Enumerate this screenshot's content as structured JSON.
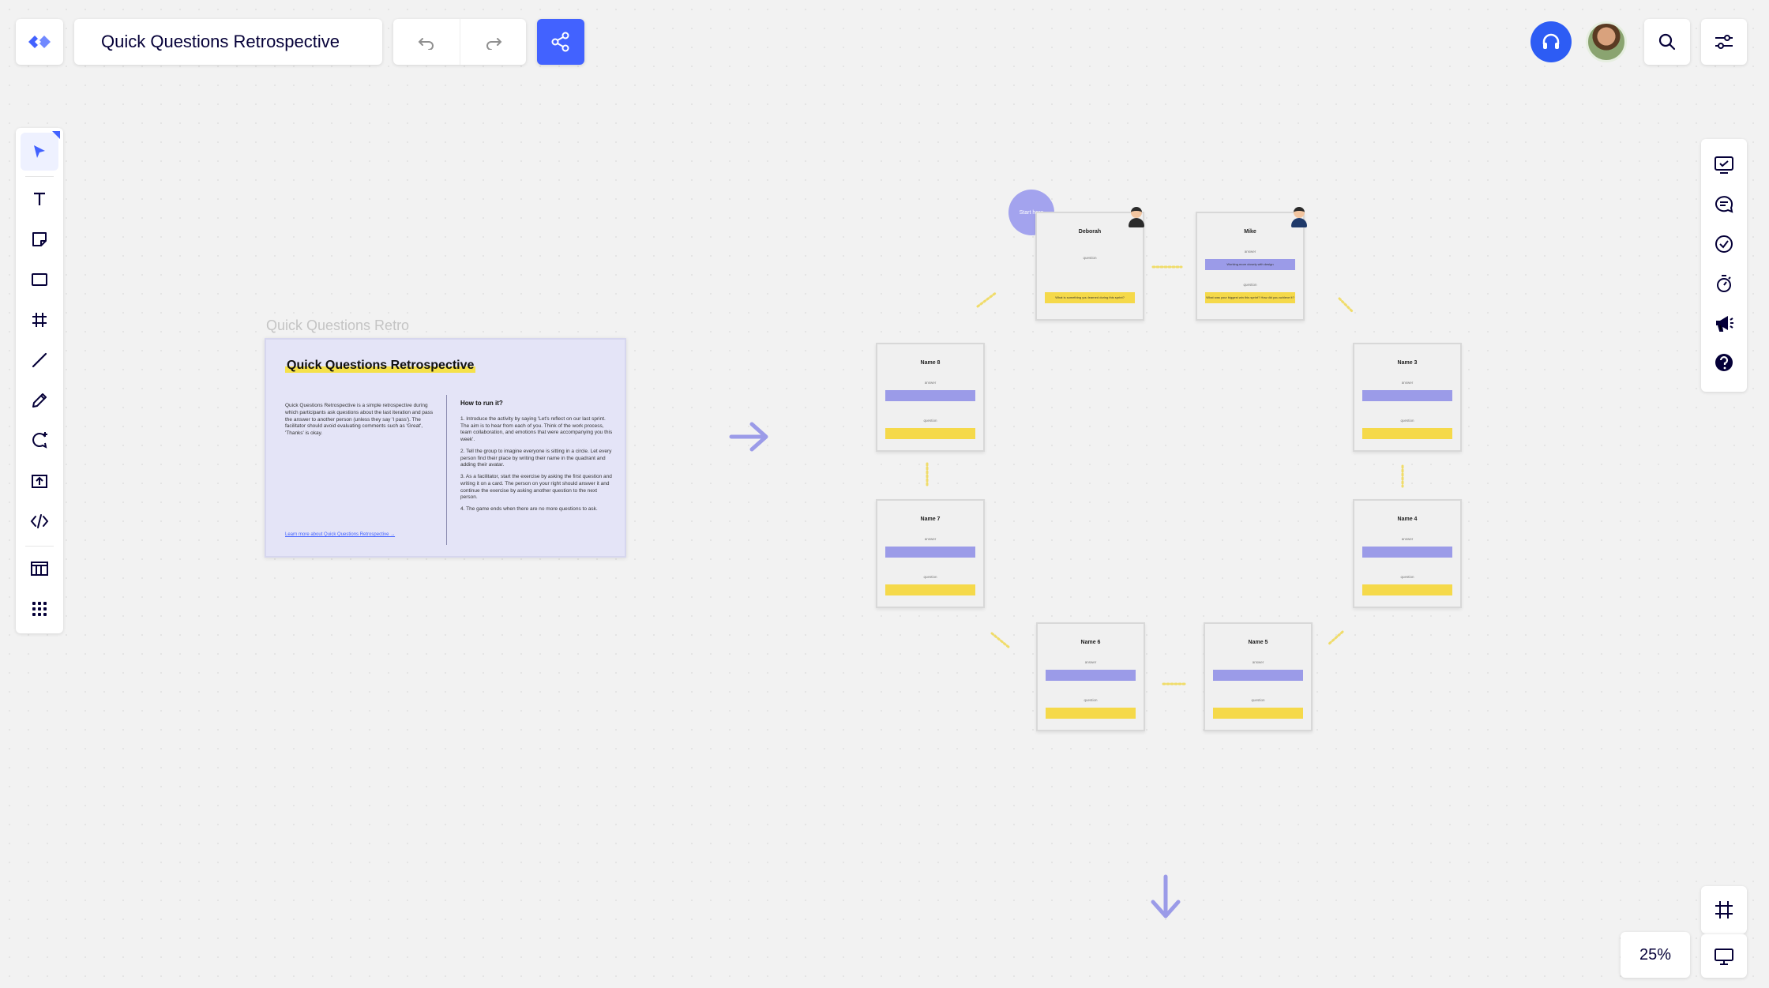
{
  "app": {
    "board_title": "Quick Questions Retrospective",
    "zoom": "25%",
    "accent": "#4262ff"
  },
  "toolbar_top": {
    "logo_icon": "miro-logo-icon",
    "undo_icon": "undo-icon",
    "redo_icon": "redo-icon",
    "share_icon": "share-icon"
  },
  "left_tools": [
    {
      "name": "select-tool",
      "icon": "cursor-arrow-icon",
      "active": true
    },
    {
      "name": "text-tool",
      "icon": "text-icon"
    },
    {
      "name": "sticky-note-tool",
      "icon": "sticky-note-icon"
    },
    {
      "name": "shape-tool",
      "icon": "rectangle-icon"
    },
    {
      "name": "frame-tool",
      "icon": "frame-icon"
    },
    {
      "name": "line-tool",
      "icon": "line-icon"
    },
    {
      "name": "pen-tool",
      "icon": "pen-icon"
    },
    {
      "name": "comment-tool",
      "icon": "comment-add-icon"
    },
    {
      "name": "upload-tool",
      "icon": "upload-icon"
    },
    {
      "name": "embed-tool",
      "icon": "code-icon"
    },
    {
      "name": "templates-tool",
      "icon": "templates-icon"
    },
    {
      "name": "more-apps-tool",
      "icon": "grid-dots-icon"
    }
  ],
  "right_tools": [
    {
      "name": "activity-tool",
      "icon": "board-check-icon"
    },
    {
      "name": "chat-tool",
      "icon": "chat-icon"
    },
    {
      "name": "tasks-tool",
      "icon": "check-circle-icon"
    },
    {
      "name": "timer-tool",
      "icon": "timer-icon"
    },
    {
      "name": "announcements-tool",
      "icon": "megaphone-icon"
    },
    {
      "name": "help-tool",
      "icon": "help-icon"
    }
  ],
  "board": {
    "frame_label": "Quick Questions Retro",
    "info_card": {
      "title": "Quick Questions Retrospective",
      "left_text": "Quick Questions Retrospective is a simple retrospective during which participants ask questions about the last iteration and pass the answer to another person (unless they say 'I pass'). The facilitator should avoid evaluating comments such as 'Great', 'Thanks' is okay.",
      "how_title": "How to run it?",
      "steps": [
        "1. Introduce the activity by saying 'Let's reflect on our last sprint. The aim is to hear from each of you. Think of the work process, team collaboration, and emotions that were accompanying you this week'.",
        "2. Tell the group to imagine everyone is sitting in a circle. Let every person find their place by writing their name in the quadrant and adding their avatar.",
        "3. As a facilitator, start the exercise by asking the first question and writing it on a card. The person on your right should answer it and continue the exercise by asking another question to the next person.",
        "4. The game ends when there are no more questions to ask."
      ],
      "link": "Learn more about Quick Questions Retrospective →"
    },
    "start_here": "Start here",
    "cards": [
      {
        "name": "Deborah",
        "answer_label": "",
        "question_label": "question",
        "answer_text": "",
        "question_text": "What is something you learned during this sprint?"
      },
      {
        "name": "Mike",
        "answer_label": "answer",
        "question_label": "question",
        "answer_text": "Working more closely with design",
        "question_text": "What was your biggest win this sprint? How did you achieve it?"
      },
      {
        "name": "Name 3",
        "answer_label": "answer",
        "question_label": "question"
      },
      {
        "name": "Name 4",
        "answer_label": "answer",
        "question_label": "question"
      },
      {
        "name": "Name 5",
        "answer_label": "answer",
        "question_label": "question"
      },
      {
        "name": "Name 6",
        "answer_label": "answer",
        "question_label": "question"
      },
      {
        "name": "Name 7",
        "answer_label": "answer",
        "question_label": "question"
      },
      {
        "name": "Name 8",
        "answer_label": "answer",
        "question_label": "question"
      }
    ]
  }
}
